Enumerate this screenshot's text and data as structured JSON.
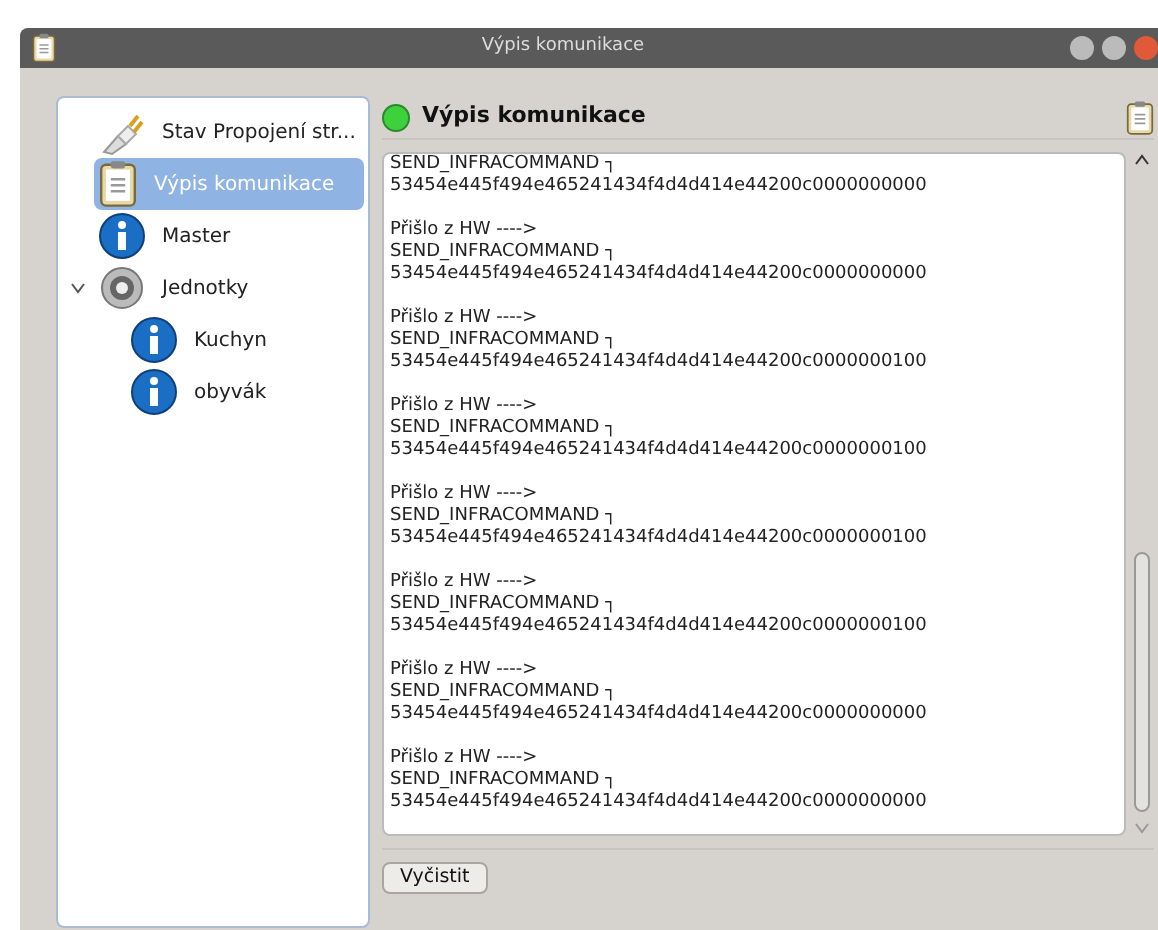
{
  "window": {
    "title": "Výpis komunikace"
  },
  "sidebar": {
    "items": [
      {
        "label": "Stav Propojení str...",
        "kind": "plug",
        "selected": false
      },
      {
        "label": "Výpis komunikace",
        "kind": "clipboard",
        "selected": true
      },
      {
        "label": "Master",
        "kind": "info",
        "selected": false
      },
      {
        "label": "Jednotky",
        "kind": "speaker",
        "selected": false,
        "expanded": true,
        "children": [
          {
            "label": "Kuchyn",
            "kind": "info",
            "selected": false
          },
          {
            "label": "obyvák",
            "kind": "info",
            "selected": false
          }
        ]
      }
    ]
  },
  "panel": {
    "title": "Výpis komunikace",
    "connected": true
  },
  "log": {
    "entries": [
      {
        "lines": [
          "SEND_INFRACOMMAND ┐",
          "53454e445f494e465241434f4d4d414e44200c0000000000"
        ]
      },
      {
        "lines": [
          "Přišlo z HW ---->",
          "SEND_INFRACOMMAND ┐",
          "53454e445f494e465241434f4d4d414e44200c0000000000"
        ]
      },
      {
        "lines": [
          "Přišlo z HW ---->",
          "SEND_INFRACOMMAND ┐",
          "53454e445f494e465241434f4d4d414e44200c0000000100"
        ]
      },
      {
        "lines": [
          "Přišlo z HW ---->",
          "SEND_INFRACOMMAND ┐",
          "53454e445f494e465241434f4d4d414e44200c0000000100"
        ]
      },
      {
        "lines": [
          "Přišlo z HW ---->",
          "SEND_INFRACOMMAND ┐",
          "53454e445f494e465241434f4d4d414e44200c0000000100"
        ]
      },
      {
        "lines": [
          "Přišlo z HW ---->",
          "SEND_INFRACOMMAND ┐",
          "53454e445f494e465241434f4d4d414e44200c0000000100"
        ]
      },
      {
        "lines": [
          "Přišlo z HW ---->",
          "SEND_INFRACOMMAND ┐",
          "53454e445f494e465241434f4d4d414e44200c0000000000"
        ]
      },
      {
        "lines": [
          "Přišlo z HW ---->",
          "SEND_INFRACOMMAND ┐",
          "53454e445f494e465241434f4d4d414e44200c0000000000"
        ]
      }
    ]
  },
  "buttons": [
    "Vyčistit"
  ]
}
